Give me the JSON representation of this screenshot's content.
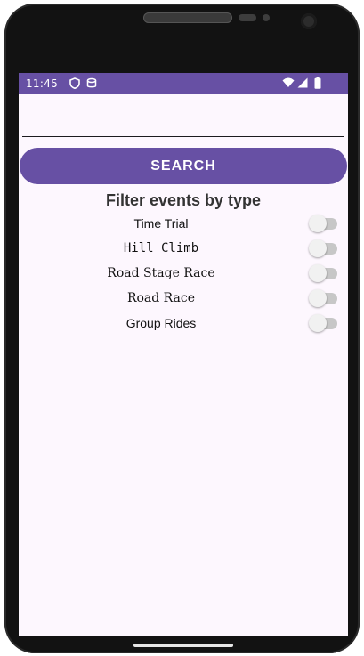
{
  "status_bar": {
    "time": "11:45",
    "icons": [
      "shield-icon",
      "storage-icon",
      "wifi-icon",
      "signal-icon",
      "battery-icon"
    ],
    "color": "#6750a4"
  },
  "search": {
    "value": "",
    "placeholder": "",
    "button_label": "SEARCH"
  },
  "filter": {
    "title": "Filter events by type",
    "items": [
      {
        "label": "Time Trial",
        "enabled": false
      },
      {
        "label": "Hill Climb",
        "enabled": false
      },
      {
        "label": "Road Stage Race",
        "enabled": false
      },
      {
        "label": "Road Race",
        "enabled": false
      },
      {
        "label": "Group Rides",
        "enabled": false
      }
    ]
  },
  "colors": {
    "accent": "#6750a4",
    "screen_background": "#fdf7fe",
    "toggle_off_track": "#c7c7c7",
    "toggle_off_thumb": "#f1f1f1"
  }
}
